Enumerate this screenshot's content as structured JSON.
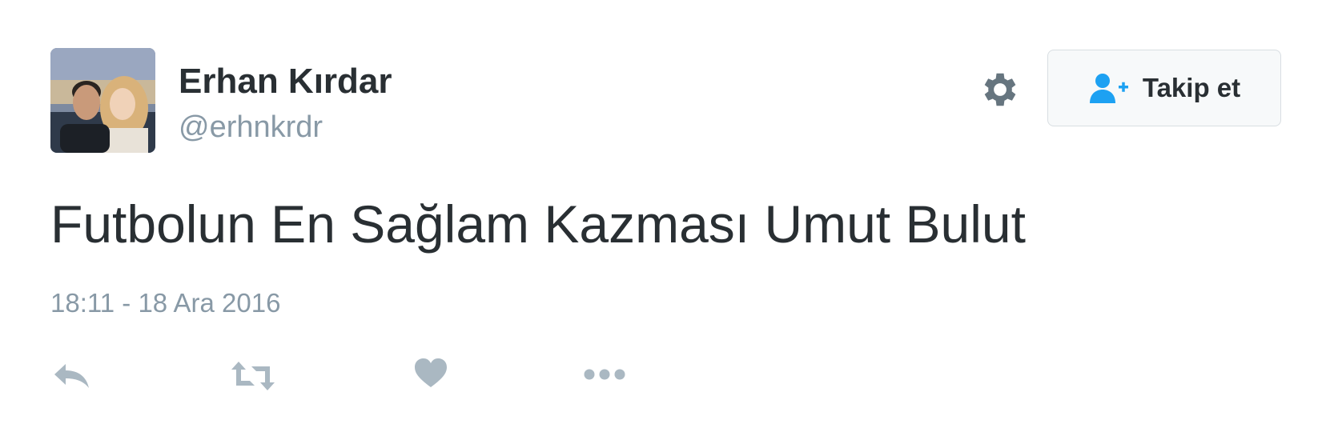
{
  "author": {
    "name": "Erhan Kırdar",
    "handle": "@erhnkrdr"
  },
  "follow_button": {
    "label": "Takip et",
    "icon": "add-user-icon"
  },
  "settings": {
    "icon": "gear-icon"
  },
  "tweet": {
    "text": "Futbolun En Sağlam Kazması Umut Bulut",
    "timestamp": "18:11 - 18 Ara 2016"
  },
  "actions": [
    {
      "icon": "reply-icon"
    },
    {
      "icon": "retweet-icon"
    },
    {
      "icon": "heart-icon"
    },
    {
      "icon": "more-icon"
    }
  ],
  "colors": {
    "text": "#292f33",
    "muted": "#8899a6",
    "accent": "#1da1f2",
    "icon": "#aab8c2"
  }
}
